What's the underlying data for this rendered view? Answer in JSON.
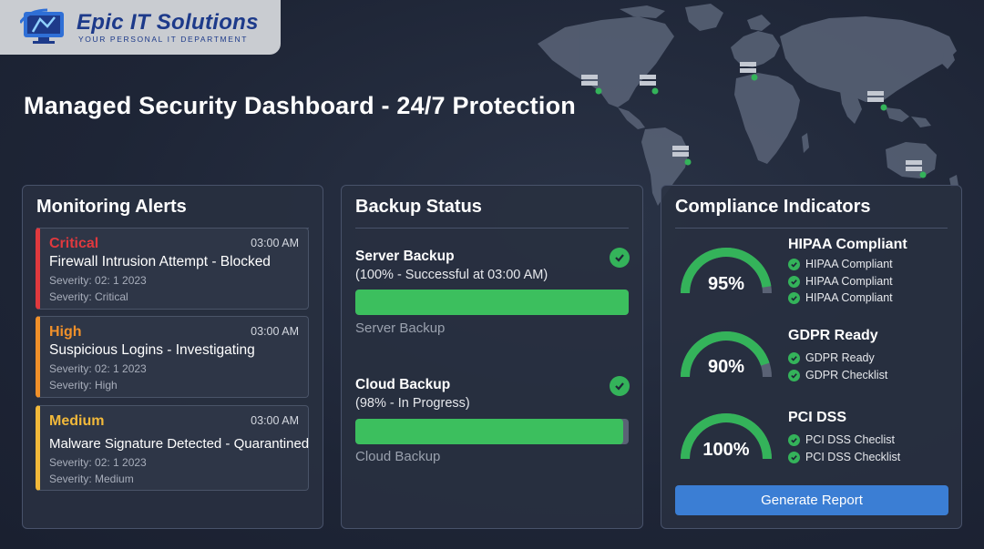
{
  "brand": {
    "name": "Epic IT Solutions",
    "tagline": "YOUR PERSONAL IT DEPARTMENT"
  },
  "page": {
    "title": "Managed Security Dashboard - 24/7 Protection"
  },
  "colors": {
    "critical": "#e0393e",
    "high": "#f0902a",
    "medium": "#f2b93a",
    "success": "#34b35a",
    "accent": "#3b7ed4"
  },
  "alerts": {
    "title": "Monitoring Alerts",
    "items": [
      {
        "level": "Critical",
        "time": "03:00 AM",
        "title": "Firewall Intrusion Attempt - Blocked",
        "date": "Severity: 02: 1 2023",
        "severity": "Severity: Critical"
      },
      {
        "level": "High",
        "time": "03:00 AM",
        "title": "Suspicious Logins - Investigating",
        "date": "Severity: 02: 1 2023",
        "severity": "Severity: High"
      },
      {
        "level": "Medium",
        "time": "03:00 AM",
        "title": "Malware Signature Detected - Quarantined",
        "date": "Severity: 02: 1 2023",
        "severity": "Severity: Medium"
      }
    ]
  },
  "backup": {
    "title": "Backup Status",
    "items": [
      {
        "label": "Server Backup",
        "detail": "(100% - Successful at 03:00 AM)",
        "progress": 100,
        "caption": "Server Backup",
        "icon": "check-circle-icon"
      },
      {
        "label": "Cloud Backup",
        "detail": "(98% - In Progress)",
        "progress": 98,
        "caption": "Cloud Backup",
        "icon": "check-circle-icon"
      }
    ]
  },
  "compliance": {
    "title": "Compliance Indicators",
    "items": [
      {
        "pct_label": "95%",
        "value": 95,
        "title": "HIPAA Compliant",
        "checks": [
          "HIPAA Compliant",
          "HIPAA Compliant",
          "HIPAA Compliant"
        ]
      },
      {
        "pct_label": "90%",
        "value": 90,
        "title": "GDPR Ready",
        "checks": [
          "GDPR Ready",
          "GDPR Checklist"
        ]
      },
      {
        "pct_label": "100%",
        "value": 100,
        "title": "PCI DSS",
        "checks": [
          "PCI DSS Checlist",
          "PCI DSS Checklist"
        ]
      }
    ],
    "button_label": "Generate Report"
  },
  "map": {
    "icon": "world-map-icon",
    "marker_icon": "server-status-icon"
  }
}
